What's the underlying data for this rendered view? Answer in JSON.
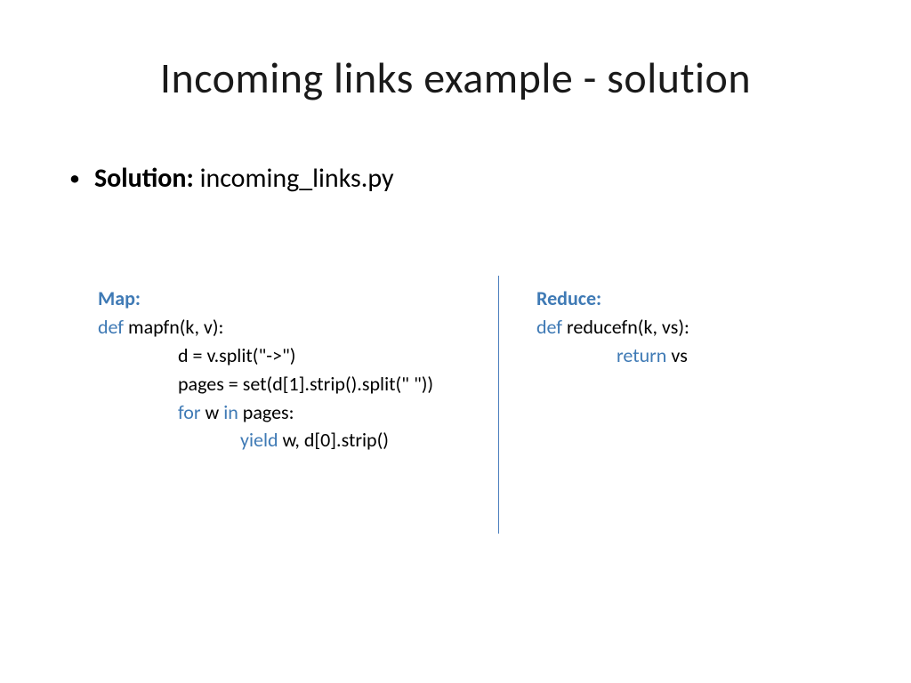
{
  "title": "Incoming links example - solution",
  "bullet": {
    "label": "Solution:",
    "value": " incoming_links.py"
  },
  "map": {
    "heading": "Map:",
    "def_kw": "def",
    "sig": " mapfn(k, v):",
    "l1": "d = v.split(\"->\")",
    "l2": "pages = set(d[1].strip().split(\" \"))",
    "for_kw": "for",
    "loop_mid": " w ",
    "in_kw": "in",
    "loop_end": " pages:",
    "yield_kw": "yield",
    "yield_rest": " w, d[0].strip()"
  },
  "reduce": {
    "heading": "Reduce:",
    "def_kw": "def",
    "sig": " reducefn(k, vs):",
    "return_kw": "return",
    "return_rest": " vs"
  }
}
